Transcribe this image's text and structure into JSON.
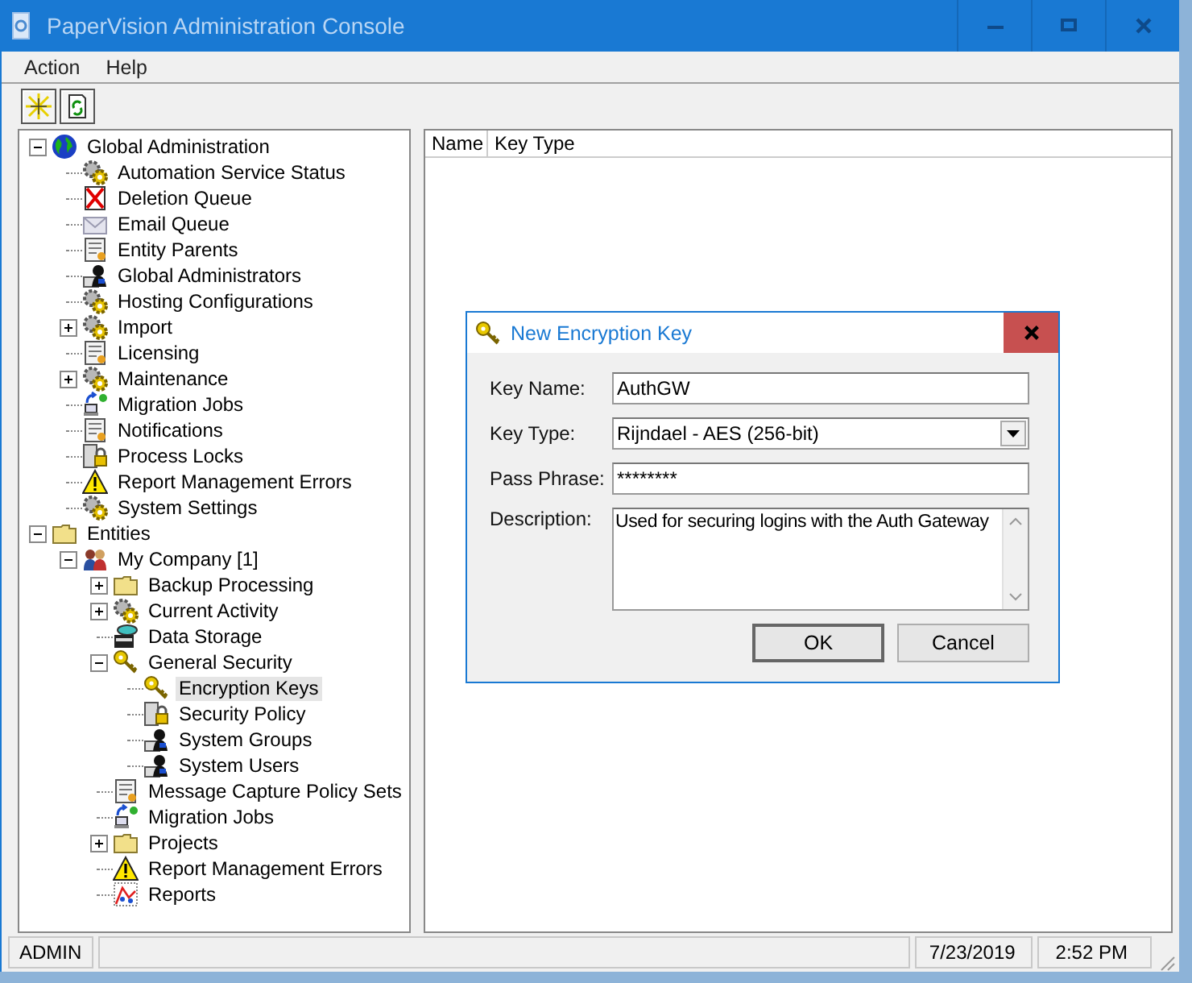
{
  "window": {
    "title": "PaperVision Administration Console"
  },
  "menu": [
    "Action",
    "Help"
  ],
  "tree": [
    {
      "label": "Global Administration",
      "expanded": true,
      "selected": false,
      "children": [
        {
          "label": "Automation Service Status",
          "selected": false
        },
        {
          "label": "Deletion Queue",
          "selected": false
        },
        {
          "label": "Email Queue",
          "selected": false
        },
        {
          "label": "Entity Parents",
          "selected": false
        },
        {
          "label": "Global Administrators",
          "selected": false
        },
        {
          "label": "Hosting Configurations",
          "selected": false
        },
        {
          "label": "Import",
          "expanded": false,
          "selected": false
        },
        {
          "label": "Licensing",
          "selected": false
        },
        {
          "label": "Maintenance",
          "expanded": false,
          "selected": false
        },
        {
          "label": "Migration Jobs",
          "selected": false
        },
        {
          "label": "Notifications",
          "selected": false
        },
        {
          "label": "Process Locks",
          "selected": false
        },
        {
          "label": "Report Management Errors",
          "selected": false
        },
        {
          "label": "System Settings",
          "selected": false
        }
      ]
    },
    {
      "label": "Entities",
      "expanded": true,
      "selected": false,
      "children": [
        {
          "label": "My Company [1]",
          "expanded": true,
          "selected": false,
          "children": [
            {
              "label": "Backup Processing",
              "expanded": false,
              "selected": false
            },
            {
              "label": "Current Activity",
              "expanded": false,
              "selected": false
            },
            {
              "label": "Data Storage",
              "selected": false
            },
            {
              "label": "General Security",
              "expanded": true,
              "selected": false,
              "children": [
                {
                  "label": "Encryption Keys",
                  "selected": true
                },
                {
                  "label": "Security Policy",
                  "selected": false
                },
                {
                  "label": "System Groups",
                  "selected": false
                },
                {
                  "label": "System Users",
                  "selected": false
                }
              ]
            },
            {
              "label": "Message Capture Policy Sets",
              "selected": false
            },
            {
              "label": "Migration Jobs",
              "selected": false
            },
            {
              "label": "Projects",
              "expanded": false,
              "selected": false
            },
            {
              "label": "Report Management Errors",
              "selected": false
            },
            {
              "label": "Reports",
              "selected": false
            }
          ]
        }
      ]
    }
  ],
  "list": {
    "columns": [
      "Name",
      "Key Type"
    ]
  },
  "dialog": {
    "title": "New Encryption Key",
    "fields": [
      {
        "kind": "text",
        "label": "Key Name:",
        "value": "AuthGW"
      },
      {
        "kind": "select",
        "label": "Key Type:",
        "value": "Rijndael - AES (256-bit)"
      },
      {
        "kind": "text",
        "label": "Pass Phrase:",
        "value": "********"
      },
      {
        "kind": "textarea",
        "label": "Description:",
        "value": "Used for securing logins with the Auth Gateway"
      }
    ],
    "buttons": [
      "OK",
      "Cancel"
    ]
  },
  "status_bar": {
    "user": "ADMIN",
    "date": "7/23/2019",
    "time": "2:52 PM"
  }
}
